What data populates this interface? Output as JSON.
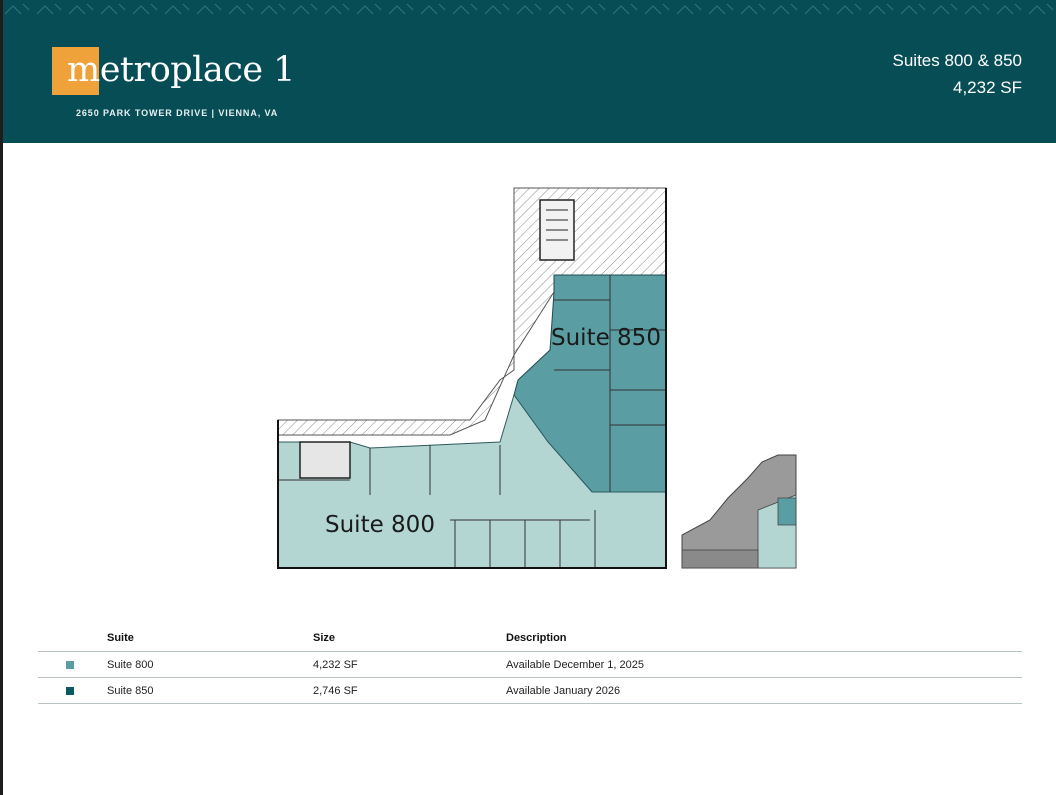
{
  "header": {
    "logo_name": "metroplace 1",
    "address": "2650 PARK TOWER DRIVE | VIENNA, VA",
    "suites_title": "Suites 800 & 850",
    "area": "4,232 SF",
    "brand_color": "#064d56",
    "logo_accent": "#f0a23a"
  },
  "floorplan": {
    "suite_800_label": "Suite 800",
    "suite_850_label": "Suite 850",
    "suite_800_color": "#b3d6d3",
    "suite_850_color": "#5a9ea4"
  },
  "table": {
    "headers": {
      "suite": "Suite",
      "size": "Size",
      "description": "Description"
    },
    "rows": [
      {
        "suite": "Suite 800",
        "size": "4,232 SF",
        "description": "Available December 1, 2025",
        "color": "#5a9ea4"
      },
      {
        "suite": "Suite 850",
        "size": "2,746 SF",
        "description": "Available January 2026",
        "color": "#0b5a61"
      }
    ]
  }
}
